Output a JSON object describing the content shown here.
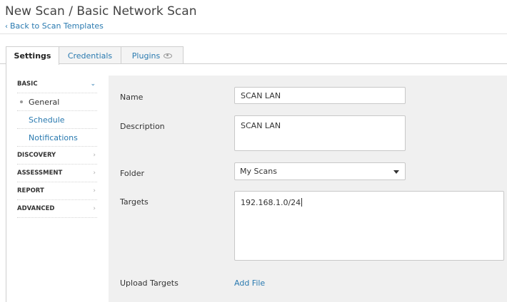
{
  "header": {
    "title": "New Scan / Basic Network Scan",
    "back_label": "Back to Scan Templates"
  },
  "tabs": [
    {
      "label": "Settings",
      "active": true
    },
    {
      "label": "Credentials",
      "active": false
    },
    {
      "label": "Plugins",
      "active": false
    }
  ],
  "sidebar": {
    "sections": [
      {
        "label": "BASIC",
        "expanded": true
      },
      {
        "label": "DISCOVERY",
        "expanded": false
      },
      {
        "label": "ASSESSMENT",
        "expanded": false
      },
      {
        "label": "REPORT",
        "expanded": false
      },
      {
        "label": "ADVANCED",
        "expanded": false
      }
    ],
    "basic_items": [
      "General",
      "Schedule",
      "Notifications"
    ]
  },
  "form": {
    "name": {
      "label": "Name",
      "value": "SCAN LAN"
    },
    "description": {
      "label": "Description",
      "value": "SCAN LAN"
    },
    "folder": {
      "label": "Folder",
      "value": "My Scans"
    },
    "targets": {
      "label": "Targets",
      "value": "192.168.1.0/24"
    },
    "upload": {
      "label": "Upload Targets",
      "link": "Add File"
    }
  },
  "icons": {
    "back": "chevron-left-icon",
    "plugins_tab": "eye-icon",
    "expanded": "chevron-down-icon",
    "collapsed": "chevron-right-icon",
    "select": "caret-down-icon"
  },
  "colors": {
    "link": "#2a7ab0",
    "panel_bg": "#f0f0f0"
  }
}
